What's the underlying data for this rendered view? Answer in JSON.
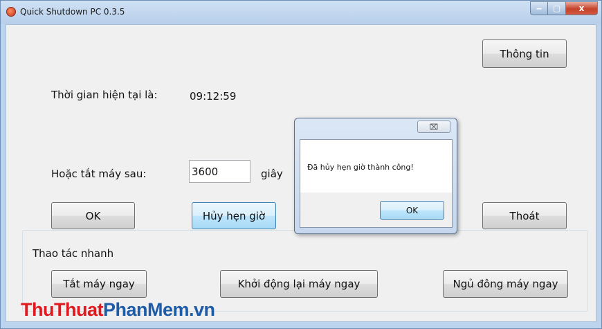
{
  "window": {
    "title": "Quick Shutdown PC 0.3.5",
    "min_symbol": "‒",
    "max_symbol": "▢",
    "close_symbol": "x"
  },
  "main": {
    "info_button": "Thông tin",
    "current_time_label": "Thời gian hiện tại là:",
    "current_time_value": "09:12:59",
    "shutdown_after_label": "Hoặc tắt máy sau:",
    "seconds_input": "3600",
    "seconds_unit": "giây",
    "ok_button": "OK",
    "cancel_schedule_button": "Hủy hẹn giờ",
    "exit_button": "Thoát"
  },
  "quick_actions": {
    "group_title": "Thao tác nhanh",
    "shutdown_now": "Tắt máy ngay",
    "restart_now": "Khởi động lại máy ngay",
    "hibernate_now": "Ngủ đông máy ngay"
  },
  "dialog": {
    "close_symbol": "⌧",
    "message": "Đã hủy hẹn giờ thành công!",
    "ok_button": "OK"
  },
  "watermark": {
    "part1": "ThuThuat",
    "part2": "PhanMem",
    "part3": ".vn",
    "color_red": "#e0191f",
    "color_blue": "#1f5ca8"
  }
}
